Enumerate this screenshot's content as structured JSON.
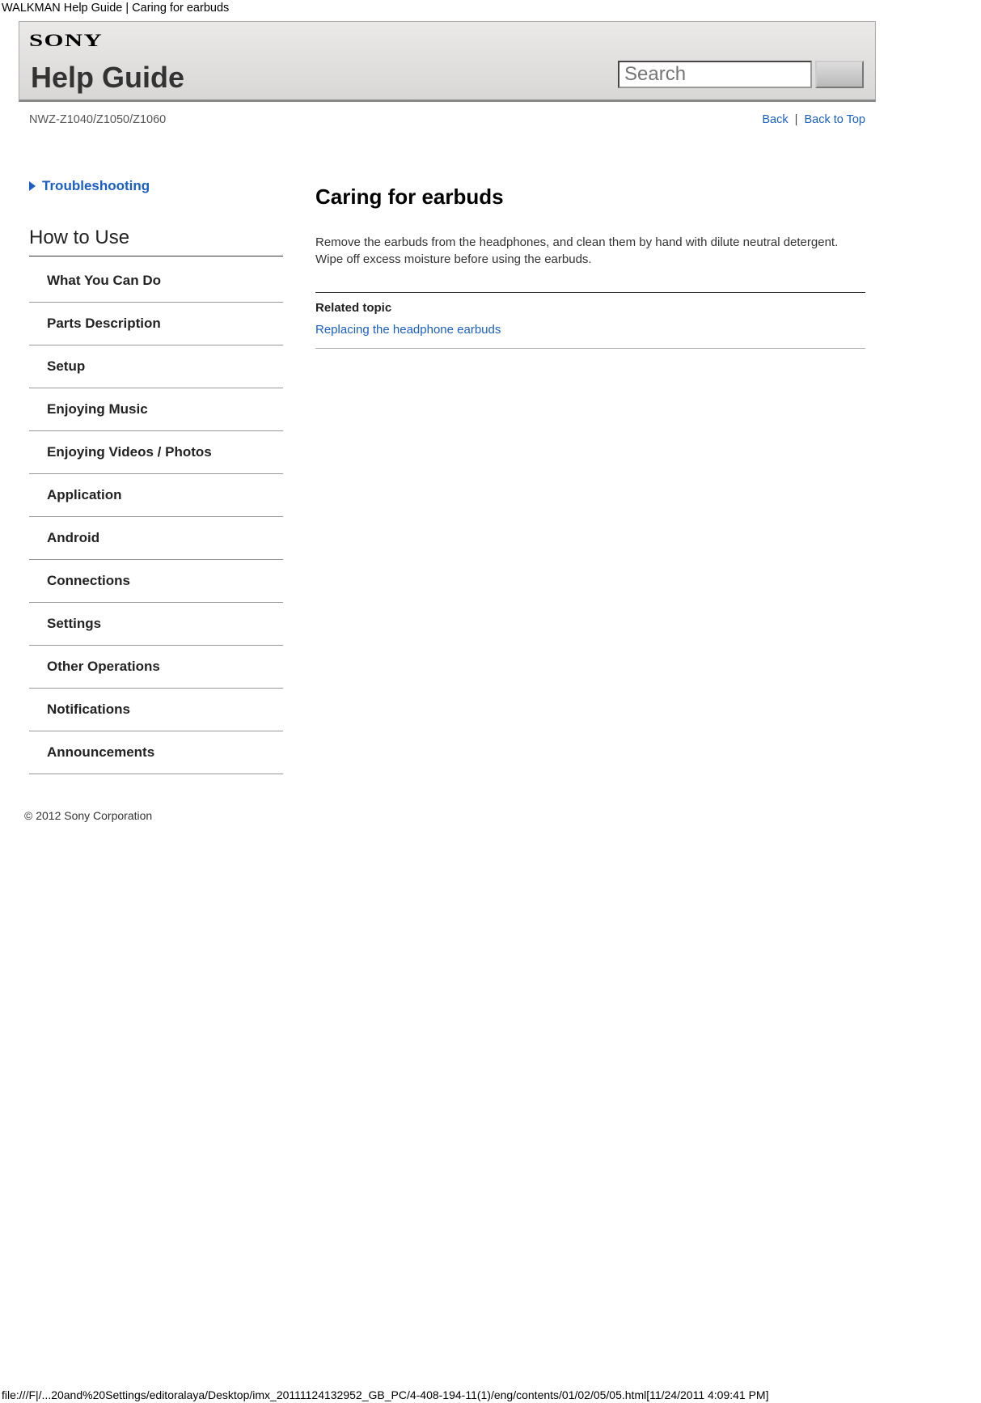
{
  "page": {
    "tab_title": "WALKMAN Help Guide | Caring for earbuds"
  },
  "header": {
    "logo_text": "SONY",
    "title": "Help Guide",
    "search_placeholder": "Search"
  },
  "meta_row": {
    "model": "NWZ-Z1040/Z1050/Z1060",
    "back_label": "Back",
    "separator": "|",
    "back_to_top_label": "Back to Top"
  },
  "sidebar": {
    "troubleshooting_label": "Troubleshooting",
    "howto_heading": "How to Use",
    "items": [
      "What You Can Do",
      "Parts Description",
      "Setup",
      "Enjoying Music",
      "Enjoying Videos / Photos",
      "Application",
      "Android",
      "Connections",
      "Settings",
      "Other Operations",
      "Notifications",
      "Announcements"
    ]
  },
  "article": {
    "title": "Caring for earbuds",
    "body": "Remove the earbuds from the headphones, and clean them by hand with dilute neutral detergent. Wipe off excess moisture before using the earbuds.",
    "related_heading": "Related topic",
    "related_link_label": "Replacing the headphone earbuds"
  },
  "footer": {
    "copyright": "© 2012 Sony Corporation",
    "file_path": "file:///F|/...20and%20Settings/editoralaya/Desktop/imx_20111124132952_GB_PC/4-408-194-11(1)/eng/contents/01/02/05/05.html[11/24/2011 4:09:41 PM]"
  }
}
